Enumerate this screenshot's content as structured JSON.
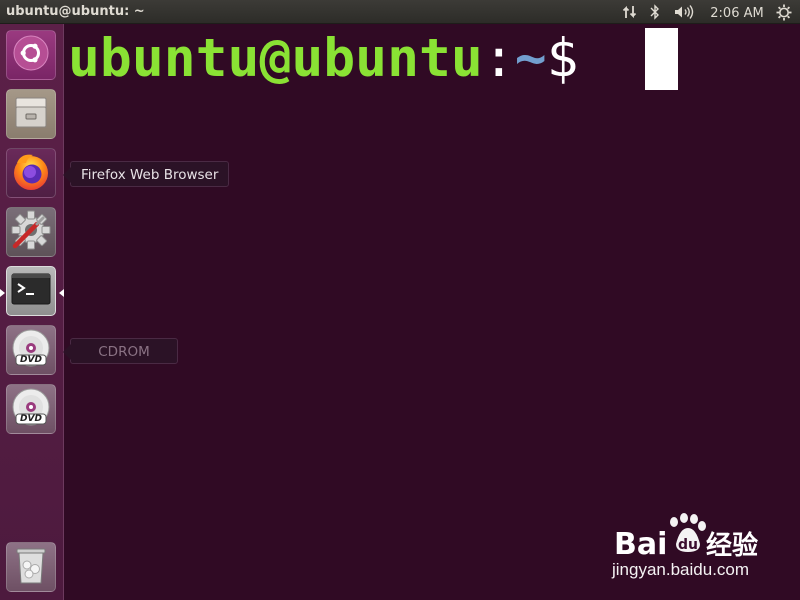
{
  "top_panel": {
    "window_title": "ubuntu@ubuntu: ~",
    "clock": "2:06 AM",
    "indicators": [
      "network-icon",
      "bluetooth-icon",
      "sound-icon",
      "power-icon"
    ]
  },
  "launcher": {
    "items": [
      {
        "name": "dash",
        "icon": "ubuntu-logo-icon"
      },
      {
        "name": "files",
        "icon": "file-cabinet-icon"
      },
      {
        "name": "firefox",
        "icon": "firefox-icon"
      },
      {
        "name": "system-settings",
        "icon": "settings-gear-icon"
      },
      {
        "name": "terminal",
        "icon": "terminal-icon",
        "running": true
      },
      {
        "name": "dvd",
        "icon": "dvd-icon"
      },
      {
        "name": "dvd",
        "icon": "dvd-icon"
      },
      {
        "name": "trash",
        "icon": "trash-icon"
      }
    ],
    "dvd_label": "DVD"
  },
  "tooltips": {
    "firefox": "Firefox Web Browser",
    "cdrom": "CDROM"
  },
  "terminal": {
    "user_host": "ubuntu@ubuntu",
    "colon": ":",
    "path": "~",
    "dollar": "$"
  },
  "watermark": {
    "brand": "Bai度经验",
    "url": "jingyan.baidu.com"
  },
  "colors": {
    "terminal_bg": "#300a24",
    "prompt_user": "#8ae234",
    "prompt_path": "#729fcf",
    "launcher_bg": "#5c2048"
  }
}
